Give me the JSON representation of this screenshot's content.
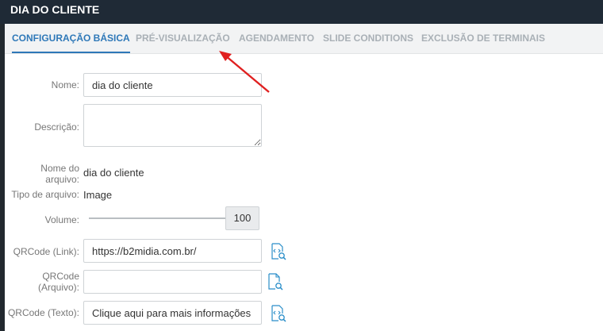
{
  "window": {
    "title": "DIA DO CLIENTE"
  },
  "tabs": [
    {
      "label": "CONFIGURAÇÃO BÁSICA",
      "active": true
    },
    {
      "label": "PRÉ-VISUALIZAÇÃO",
      "active": false
    },
    {
      "label": "AGENDAMENTO",
      "active": false
    },
    {
      "label": "SLIDE CONDITIONS",
      "active": false
    },
    {
      "label": "EXCLUSÃO DE TERMINAIS",
      "active": false
    }
  ],
  "form": {
    "nome": {
      "label": "Nome:",
      "value": "dia do cliente"
    },
    "descricao": {
      "label": "Descrição:",
      "value": ""
    },
    "nome_arquivo": {
      "label_line1": "Nome do",
      "label_line2": "arquivo:",
      "value": "dia do cliente"
    },
    "tipo_arquivo": {
      "label": "Tipo de arquivo:",
      "value": "Image"
    },
    "volume": {
      "label": "Volume:",
      "value": "100",
      "level_percent": 100
    },
    "qrcode_link": {
      "label": "QRCode (Link):",
      "value": "https://b2midia.com.br/"
    },
    "qrcode_arquivo": {
      "label_line1": "QRCode",
      "label_line2": "(Arquivo):",
      "value": ""
    },
    "qrcode_texto": {
      "label": "QRCode (Texto):",
      "value": "Clique aqui para mais informações"
    }
  },
  "colors": {
    "title_bg": "#1f2a36",
    "accent": "#2e78b8",
    "tab_inactive": "#a9b0b6",
    "annotation_arrow": "#e02020",
    "icon": "#2a8ec9"
  },
  "icons": {
    "qrcode_link_icon": "code-search-icon",
    "qrcode_arquivo_icon": "file-search-icon",
    "qrcode_texto_icon": "code-search-icon"
  }
}
